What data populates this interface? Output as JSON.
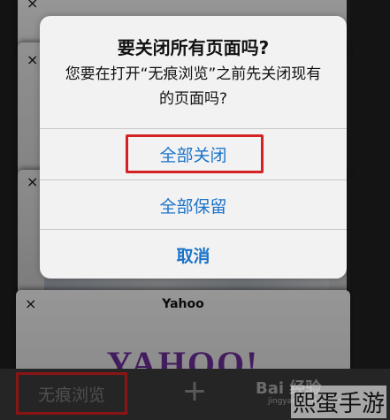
{
  "tabs": [
    {
      "close_icon": "×"
    },
    {
      "close_icon": "×"
    },
    {
      "close_icon": "×"
    },
    {
      "close_icon": "×",
      "title": "Yahoo",
      "logo": "YAHOO!"
    }
  ],
  "alert": {
    "title": "要关闭所有页面吗?",
    "message": "您要在打开“无痕浏览”之前先关闭现有的页面吗?",
    "buttons": {
      "close_all": "全部关闭",
      "keep_all": "全部保留",
      "cancel": "取消"
    },
    "accent_color": "#1a73c9"
  },
  "toolbar": {
    "private_label": "无痕浏览",
    "new_tab_icon": "+"
  },
  "watermark": {
    "brand": "Bai 经验",
    "url": "jingyan.baidu.com",
    "corner": "熙蛋手游"
  },
  "highlight_color": "#d42121"
}
